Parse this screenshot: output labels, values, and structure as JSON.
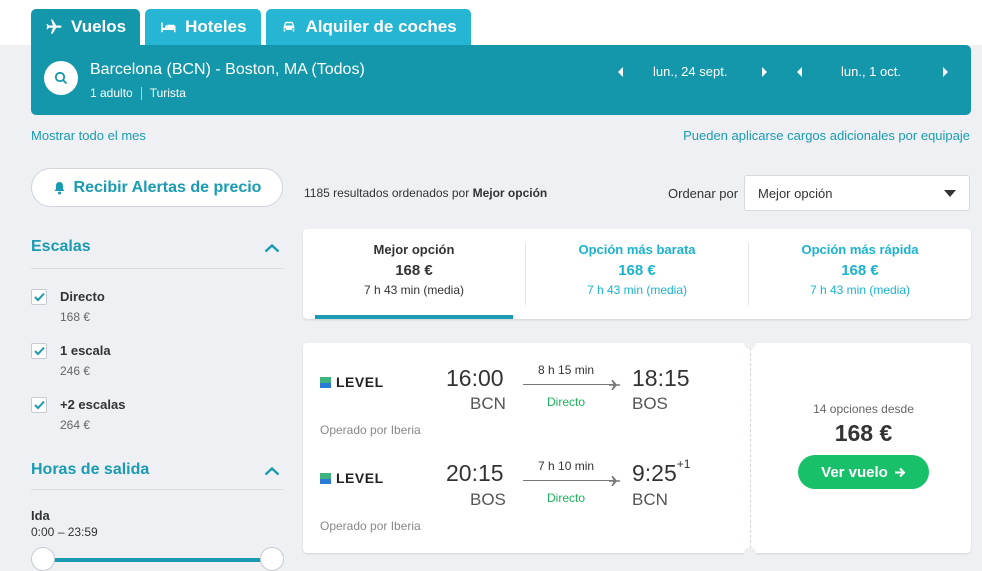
{
  "tabs": [
    {
      "label": "Vuelos",
      "icon": "plane-icon",
      "active": true
    },
    {
      "label": "Hoteles",
      "icon": "bed-icon",
      "active": false
    },
    {
      "label": "Alquiler de coches",
      "icon": "car-icon",
      "active": false
    }
  ],
  "search": {
    "route": "Barcelona (BCN) - Boston, MA (Todos)",
    "passengers": "1 adulto",
    "cabin": "Turista",
    "depart_date": "lun., 24 sept.",
    "return_date": "lun., 1 oct."
  },
  "links": {
    "show_month": "Mostrar todo el mes",
    "baggage_fees": "Pueden aplicarse cargos adicionales por equipaje"
  },
  "sidebar": {
    "alert_button": "Recibir Alertas de precio",
    "stops_title": "Escalas",
    "stops": [
      {
        "label": "Directo",
        "price": "168 €",
        "checked": true
      },
      {
        "label": "1 escala",
        "price": "246 €",
        "checked": true
      },
      {
        "label": "+2 escalas",
        "price": "264 €",
        "checked": true
      }
    ],
    "times_title": "Horas de salida",
    "ida_label": "Ida",
    "ida_range": "0:00 – 23:59"
  },
  "results": {
    "count_text": "1185 resultados ordenados por",
    "sort_name": "Mejor opción",
    "sort_label": "Ordenar por",
    "sort_value": "Mejor opción"
  },
  "options": [
    {
      "title": "Mejor opción",
      "price": "168 €",
      "duration": "7 h 43 min (media)",
      "selected": true
    },
    {
      "title": "Opción más barata",
      "price": "168 €",
      "duration": "7 h 43 min (media)",
      "selected": false
    },
    {
      "title": "Opción más rápida",
      "price": "168 €",
      "duration": "7 h 43 min (media)",
      "selected": false
    }
  ],
  "flight": {
    "legs": [
      {
        "airline": "LEVEL",
        "dep_time": "16:00",
        "dep_code": "BCN",
        "duration": "8 h 15 min",
        "stops": "Directo",
        "arr_time": "18:15",
        "arr_day": "",
        "arr_code": "BOS",
        "operated": "Operado por Iberia"
      },
      {
        "airline": "LEVEL",
        "dep_time": "20:15",
        "dep_code": "BOS",
        "duration": "7 h 10 min",
        "stops": "Directo",
        "arr_time": "9:25",
        "arr_day": "+1",
        "arr_code": "BCN",
        "operated": "Operado por Iberia"
      }
    ],
    "options_from": "14 opciones desde",
    "price": "168 €",
    "cta": "Ver vuelo"
  },
  "colors": {
    "primary": "#1497ab",
    "tab": "#26b5d2",
    "accent": "#1a9bb2",
    "cta": "#19c06a",
    "level_green": "#3fb37f",
    "level_blue": "#2b7bd6"
  }
}
